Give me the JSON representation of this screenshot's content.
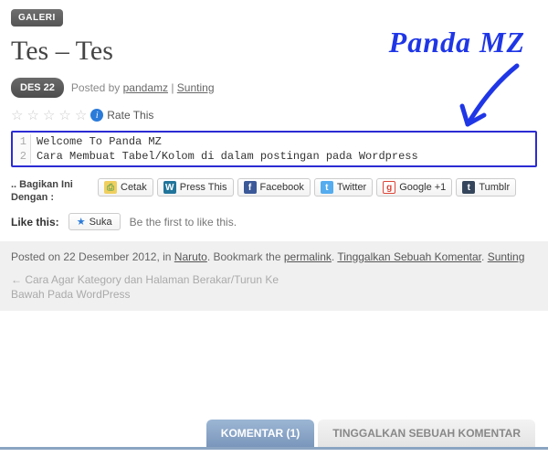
{
  "category": "GALERI",
  "title": "Tes – Tes",
  "date": "DES 22",
  "posted_by_prefix": "Posted by ",
  "author": "pandamz",
  "separator": " | ",
  "edit_label": "Sunting",
  "rate_label": "Rate This",
  "code": {
    "lines": [
      {
        "n": "1",
        "text": "Welcome To Panda MZ"
      },
      {
        "n": "2",
        "text": "Cara Membuat Tabel/Kolom di dalam postingan pada Wordpress"
      }
    ]
  },
  "share_label": ".. Bagikan Ini Dengan :",
  "share_buttons": {
    "print": "Cetak",
    "pressthis": "Press This",
    "facebook": "Facebook",
    "twitter": "Twitter",
    "google": "Google +1",
    "tumblr": "Tumblr"
  },
  "like": {
    "label": "Like this:",
    "button": "Suka",
    "text": "Be the first to like this."
  },
  "footer": {
    "posted_on": "Posted on 22 Desember 2012, in ",
    "cat": "Naruto",
    "mid1": ". Bookmark the ",
    "permalink": "permalink",
    "mid2": ". ",
    "leave": "Tinggalkan Sebuah Komentar",
    "mid3": ". ",
    "edit": "Sunting"
  },
  "prev_post": "← Cara Agar Kategory dan Halaman Berakar/Turun Ke Bawah Pada WordPress",
  "tabs": {
    "comments": "KOMENTAR (1)",
    "leave": "TINGGALKAN SEBUAH KOMENTAR"
  },
  "annotation": "Panda MZ"
}
